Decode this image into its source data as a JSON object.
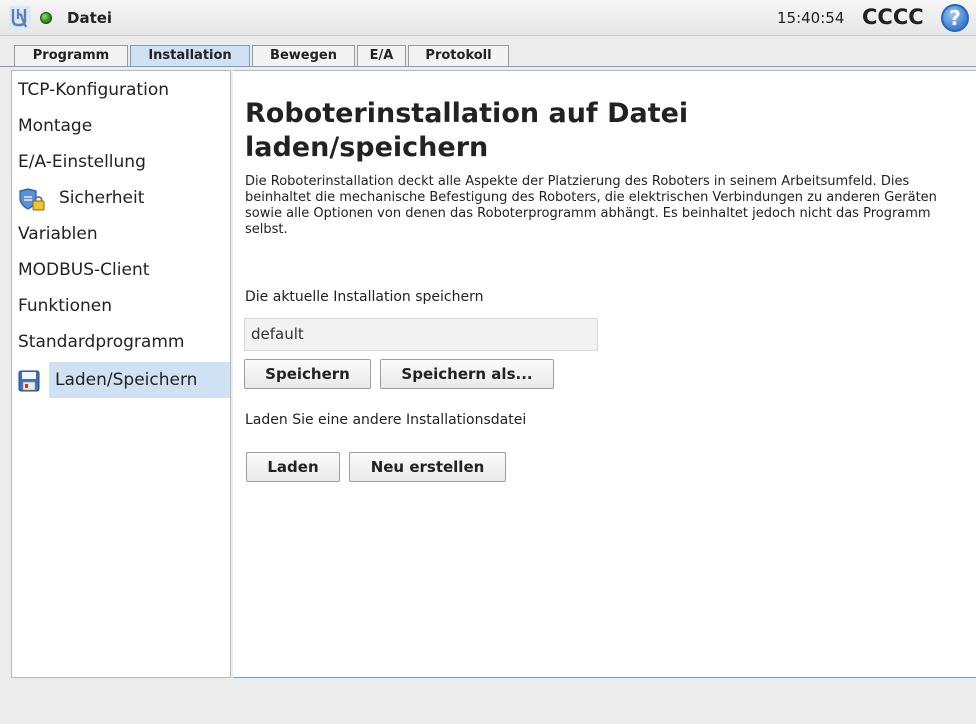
{
  "topbar": {
    "file_label": "Datei",
    "clock": "15:40:54",
    "robot_name": "CCCC",
    "help_glyph": "?"
  },
  "tabs": [
    {
      "label": "Programm",
      "active": false
    },
    {
      "label": "Installation",
      "active": true
    },
    {
      "label": "Bewegen",
      "active": false
    },
    {
      "label": "E/A",
      "active": false
    },
    {
      "label": "Protokoll",
      "active": false
    }
  ],
  "sidebar": {
    "items": [
      {
        "label": "TCP-Konfiguration"
      },
      {
        "label": "Montage"
      },
      {
        "label": "E/A-Einstellung"
      },
      {
        "label": "Sicherheit",
        "icon": "shield-lock-icon"
      },
      {
        "label": "Variablen"
      },
      {
        "label": "MODBUS-Client"
      },
      {
        "label": "Funktionen"
      },
      {
        "label": "Standardprogramm"
      },
      {
        "label": "Laden/Speichern",
        "icon": "floppy-disk-icon",
        "selected": true
      }
    ]
  },
  "main": {
    "title": "Roboterinstallation auf Datei laden/speichern",
    "description": "Die Roboterinstallation deckt alle Aspekte der Platzierung des Roboters in seinem Arbeitsumfeld. Dies beinhaltet die mechanische Befestigung des Roboters, die elektrischen Verbindungen zu anderen Geräten sowie alle Optionen von denen das Roboterprogramm abhängt. Es beinhaltet jedoch nicht das Programm selbst.",
    "save_section_label": "Die aktuelle Installation speichern",
    "installation_name": "default",
    "save_button": "Speichern",
    "save_as_button": "Speichern als...",
    "load_section_label": "Laden Sie eine andere Installationsdatei",
    "load_button": "Laden",
    "new_button": "Neu erstellen"
  },
  "colors": {
    "accent": "#cfe1f3",
    "status_ok": "#3a9a1c",
    "help_blue": "#3a7fd0"
  }
}
